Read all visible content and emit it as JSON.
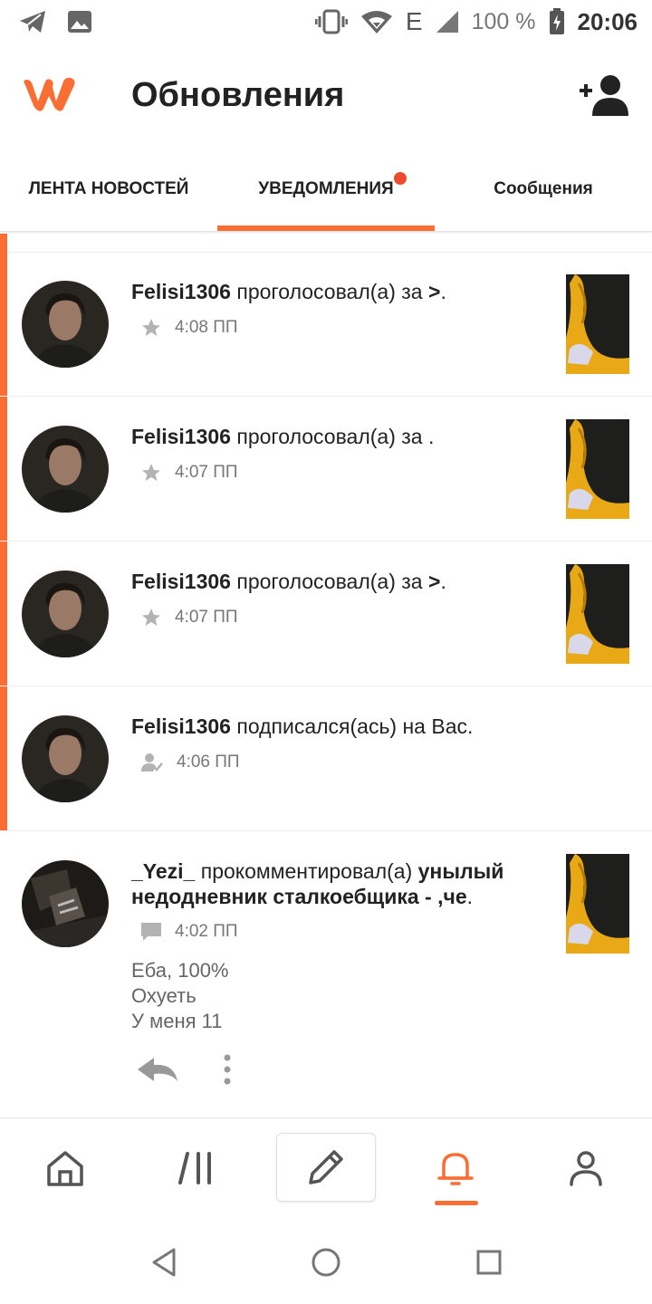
{
  "status_bar": {
    "battery_percent": "100 %",
    "time": "20:06",
    "network_type": "E",
    "icons": [
      "telegram-icon",
      "image-icon",
      "vibrate-icon",
      "wifi-icon",
      "signal-icon",
      "battery-charging-icon"
    ]
  },
  "header": {
    "title": "Обновления",
    "logo": "wattpad-logo",
    "action_icon": "add-user-icon"
  },
  "tabs": [
    {
      "label": "ЛЕНТА НОВОСТЕЙ",
      "active": false
    },
    {
      "label": "УВЕДОМЛЕНИЯ",
      "active": true,
      "badge": true
    },
    {
      "label": "Сообщения",
      "active": false
    }
  ],
  "notifications": [
    {
      "user": "Felisi1306",
      "action": " проголосовал(а) за ",
      "target": ">",
      "suffix": ".",
      "time": "4:08 ПП",
      "icon": "star-icon",
      "unread": true
    },
    {
      "user": "Felisi1306",
      "action": " проголосовал(а) за ",
      "target": "",
      "suffix": ".",
      "time": "4:07 ПП",
      "icon": "star-icon",
      "unread": true
    },
    {
      "user": "Felisi1306",
      "action": " проголосовал(а) за ",
      "target": ">",
      "suffix": ".",
      "time": "4:07 ПП",
      "icon": "star-icon",
      "unread": true
    },
    {
      "user": "Felisi1306",
      "action": " подписался(ась) на Вас.",
      "target": "",
      "suffix": "",
      "time": "4:06 ПП",
      "icon": "follow-icon",
      "unread": true
    },
    {
      "user": "_Yezi_",
      "action": " прокомментировал(а) ",
      "target": "унылый недодневник сталкоебщика - ,че",
      "suffix": ".",
      "time": "4:02 ПП",
      "icon": "comment-icon",
      "unread": false,
      "comment_lines": [
        "Еба, 100%",
        "Охуеть",
        "У меня 11"
      ]
    }
  ],
  "bottom_nav": [
    "home-icon",
    "library-icon",
    "write-icon",
    "notifications-icon",
    "profile-icon"
  ],
  "system_nav": [
    "back-icon",
    "home-circle-icon",
    "recents-icon"
  ],
  "colors": {
    "accent": "#f96e32",
    "badge": "#ec4b2d"
  }
}
